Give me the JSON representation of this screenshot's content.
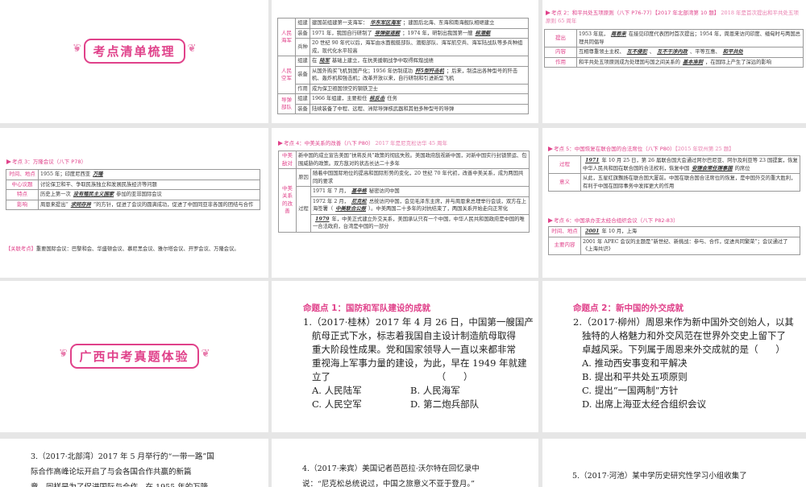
{
  "colors": {
    "accent": "#e0418a"
  },
  "slide_military": {
    "table": {
      "groups": [
        {
          "label": "人民海军",
          "items": [
            {
              "sub": "组建",
              "parts": [
                {
                  "t": "建国前组建第一支海军："
                },
                {
                  "b": "华东军区海军"
                },
                {
                  "t": "；建国后北海、东海和南海舰队相继建立"
                }
              ]
            },
            {
              "sub": "装备",
              "parts": [
                {
                  "t": "1971 年，我国自行研制了"
                },
                {
                  "b": "导弹驱逐舰"
                },
                {
                  "t": "；1974 年，研制出我国第一艘"
                },
                {
                  "b": "核潜艇"
                }
              ]
            },
            {
              "sub": "兵种",
              "parts": [
                {
                  "t": "20 世纪 90 年代以后，海军由水面舰艇部队、潜艇部队、海军航空兵、海军陆战队等多兵种组成，现代化水平较高"
                }
              ]
            }
          ]
        },
        {
          "label": "人民空军",
          "items": [
            {
              "sub": "组建",
              "parts": [
                {
                  "t": "在"
                },
                {
                  "b": "陆军"
                },
                {
                  "t": "基础上建立，在抗美援朝战争中取得辉煌战绩"
                }
              ]
            },
            {
              "sub": "装备",
              "parts": [
                {
                  "t": "从国外购买飞机到国产化；1956 年仿制成功"
                },
                {
                  "b": "歼5型歼击机"
                },
                {
                  "t": "；后来，制造出各种型号的歼击机、轰炸机和强击机；改革开放以来，自行研制和引进新型飞机"
                }
              ]
            },
            {
              "sub": "作用",
              "parts": [
                {
                  "t": "成为保卫祖国领空的钢铁卫士"
                }
              ]
            }
          ]
        },
        {
          "label": "导弹部队",
          "items": [
            {
              "sub": "组建",
              "parts": [
                {
                  "t": "1966 年组建，主要担任"
                },
                {
                  "b": "核反击"
                },
                {
                  "t": "任务"
                }
              ]
            },
            {
              "sub": "装备",
              "parts": [
                {
                  "t": "陆续装备了中程、远程、洲际导弹核武器和其他多种型号的导弹"
                }
              ]
            }
          ]
        }
      ]
    }
  },
  "slide_five_principles": {
    "header": "考点 2：和平共处五项原则（八下 P76-77）【2017 年北部湾第 10 题】",
    "note": "2018 年是首次提出和平共处五项原则 65 周年",
    "table": {
      "groups": [
        {
          "label": "提出",
          "items": [
            {
              "parts": [
                {
                  "t": "1953 年底，"
                },
                {
                  "b": "周恩来"
                },
                {
                  "t": "在接见印度代表团时首次提出；1954 年，周恩来访问印度、缅甸时与两国总理共同倡导"
                }
              ]
            }
          ]
        },
        {
          "label": "内容",
          "items": [
            {
              "parts": [
                {
                  "t": "互相尊重领土主权、"
                },
                {
                  "b": "互不侵犯"
                },
                {
                  "t": "、"
                },
                {
                  "b": "互不干涉内政"
                },
                {
                  "t": "、平等互惠、"
                },
                {
                  "b": "和平共处"
                }
              ]
            }
          ]
        },
        {
          "label": "作用",
          "items": [
            {
              "parts": [
                {
                  "t": "和平共处五项原则成为处理国与国之间关系的"
                },
                {
                  "b": "基本准则"
                },
                {
                  "t": "，在国际上产生了深远的影响"
                }
              ]
            }
          ]
        }
      ]
    }
  },
  "slide_bandung": {
    "header": "考点 3：万隆会议（八下 P78）",
    "table": {
      "groups": [
        {
          "label": "时间、地点",
          "items": [
            {
              "parts": [
                {
                  "t": "1955 年；印度尼西亚"
                },
                {
                  "b": "万隆"
                }
              ]
            }
          ]
        },
        {
          "label": "中心议题",
          "items": [
            {
              "parts": [
                {
                  "t": "讨论保卫和平、争取民族独立和发展民族经济等问题"
                }
              ]
            }
          ]
        },
        {
          "label": "特点",
          "items": [
            {
              "parts": [
                {
                  "t": "历史上第一次"
                },
                {
                  "b": "没有殖民主义国家"
                },
                {
                  "t": "参加的亚非国际会议"
                }
              ]
            }
          ]
        },
        {
          "label": "影响",
          "items": [
            {
              "parts": [
                {
                  "t": "周恩来提出“"
                },
                {
                  "b": "求同存异"
                },
                {
                  "t": "”的方针，促进了会议的圆满成功，促进了中国同亚非各国的团结与合作"
                }
              ]
            }
          ]
        }
      ]
    },
    "related_label": "【关联考点】",
    "related_text": "重要国际会议：巴黎和会、华盛顿会议、慕尼黑会议、雅尔塔会议、开罗会议、万隆会议。"
  },
  "slide_sino_us": {
    "header": "考点 4：中美关系的改善（八下 P80）",
    "note": "2017 年是尼克松访华 45 周年",
    "table": {
      "groups": [
        {
          "label": "中美敌对",
          "items": [
            {
              "parts": [
                {
                  "t": "新中国的成立宣告美国“扶蒋反共”政策的彻底失败。美国政府敌视新中国，对新中国实行封锁禁运、包围威胁的政策。双方敌对的状态长达二十多年"
                }
              ]
            }
          ]
        },
        {
          "label": "中美关系的改善",
          "items": [
            {
              "sub": "原因",
              "parts": [
                {
                  "t": "随着中国国际地位的提高和国际形势的变化，20 世纪 70 年代初，改善中美关系，成为两国共同的要求"
                }
              ]
            },
            {
              "sub": "过程",
              "parts": [
                {
                  "t": "1971 年 7 月，"
                },
                {
                  "b": "基辛格"
                },
                {
                  "t": "秘密访问中国"
                }
              ]
            },
            {
              "sub": "过程",
              "parts": [
                {
                  "t": "1972 年 2 月，"
                },
                {
                  "b": "尼克松"
                },
                {
                  "t": "总统访问中国，会见毛泽东主席，并与周恩来总理举行会谈，双方在上海签署（"
                },
                {
                  "b": "中美联合公报"
                },
                {
                  "t": "）。中美两国二十多年的对抗结束了，两国关系开始走向正常化"
                }
              ]
            },
            {
              "sub": "过程",
              "parts": [
                {
                  "b": "1979"
                },
                {
                  "t": "年，中美正式建立外交关系，美国承认只有一个中国，中华人民共和国政府是中国的唯一合法政府，台湾是中国的一部分"
                }
              ]
            }
          ]
        }
      ]
    }
  },
  "slide_un": {
    "header5": "考点 5：中国恢复在联合国的合法席位（八下 P80）",
    "note5": "【2015 年钦州第 25 题】",
    "table5": {
      "groups": [
        {
          "label": "过程",
          "items": [
            {
              "parts": [
                {
                  "b": "1971"
                },
                {
                  "t": "年 10 月 25 日，第 26 届联合国大会通过阿尔巴尼亚、阿尔及利亚等 23 国提案，恢复中华人民共和国在联合国的合法权利，恢复中国"
                },
                {
                  "b": "安理会常任理事国"
                },
                {
                  "t": "的席位"
                }
              ]
            }
          ]
        },
        {
          "label": "意义",
          "items": [
            {
              "parts": [
                {
                  "t": "从此，五星红旗飘扬在联合国大厦前。中国在联合国合法席位的恢复，是中国外交的重大胜利，有利于中国在国际事务中发挥更大的作用"
                }
              ]
            }
          ]
        }
      ]
    },
    "header6": "考点 6：中国承办亚太经合组织会议（八下 P82-83）",
    "table6": {
      "groups": [
        {
          "label": "时间、地点",
          "items": [
            {
              "parts": [
                {
                  "b": "2001"
                },
                {
                  "t": "年 10 月，上海"
                }
              ]
            }
          ]
        },
        {
          "label": "主要内容",
          "items": [
            {
              "parts": [
                {
                  "t": "2001 年 APEC 会议的主题是“新世纪、新挑战：参与、合作，促进共同繁荣”；会议通过了《上海共识》"
                }
              ]
            }
          ]
        }
      ]
    }
  },
  "banner1": "考点清单梳理",
  "banner2": "广西中考真题体验",
  "q1": {
    "heading": "命题点 1：国防和军队建设的成就",
    "lines": [
      "1.（2017·桂林）2017 年 4 月 26 日，中国第一艘国产",
      "航母正式下水，标志着我国自主设计制造航母取得",
      "重大阶段性成果。党和国家领导人一直以来都非常",
      "重视海上军事力量的建设，为此，早在 1949 年就建",
      "立了                                    （      ）"
    ],
    "options": [
      "A. 人民陆军",
      "B. 人民海军",
      "C. 人民空军",
      "D. 第二炮兵部队"
    ]
  },
  "q2": {
    "heading": "命题点 2：新中国的外交成就",
    "lines": [
      "2.（2017·柳州）周恩来作为新中国外交创始人，以其",
      "独特的人格魅力和外交风范在世界外交史上留下了",
      "卓越风采。下列属于周恩来外交成就的是（      ）"
    ],
    "options": [
      "A. 推动西安事变和平解决",
      "B. 提出和平共处五项原则",
      "C. 提出“一国两制”方针",
      "D. 出席上海亚太经合组织会议"
    ]
  },
  "q3": {
    "lines": [
      "3.（2017·北部湾）2017 年 5 月举行的“一带一路”国",
      "际合作高峰论坛开启了与会各国合作共赢的新篇",
      "章。同样是为了促进国际与合作，在 1955 年的万隆"
    ]
  },
  "q4": {
    "lines": [
      "4.（2017·来宾）美国记者芭芭拉·沃尔特在回忆录中",
      "说：“尼克松总统说过，中国之旅意义不亚于登月。”"
    ]
  },
  "q5": {
    "lines": [
      "5.（2017·河池）某中学历史研究性学习小组收集了"
    ]
  }
}
